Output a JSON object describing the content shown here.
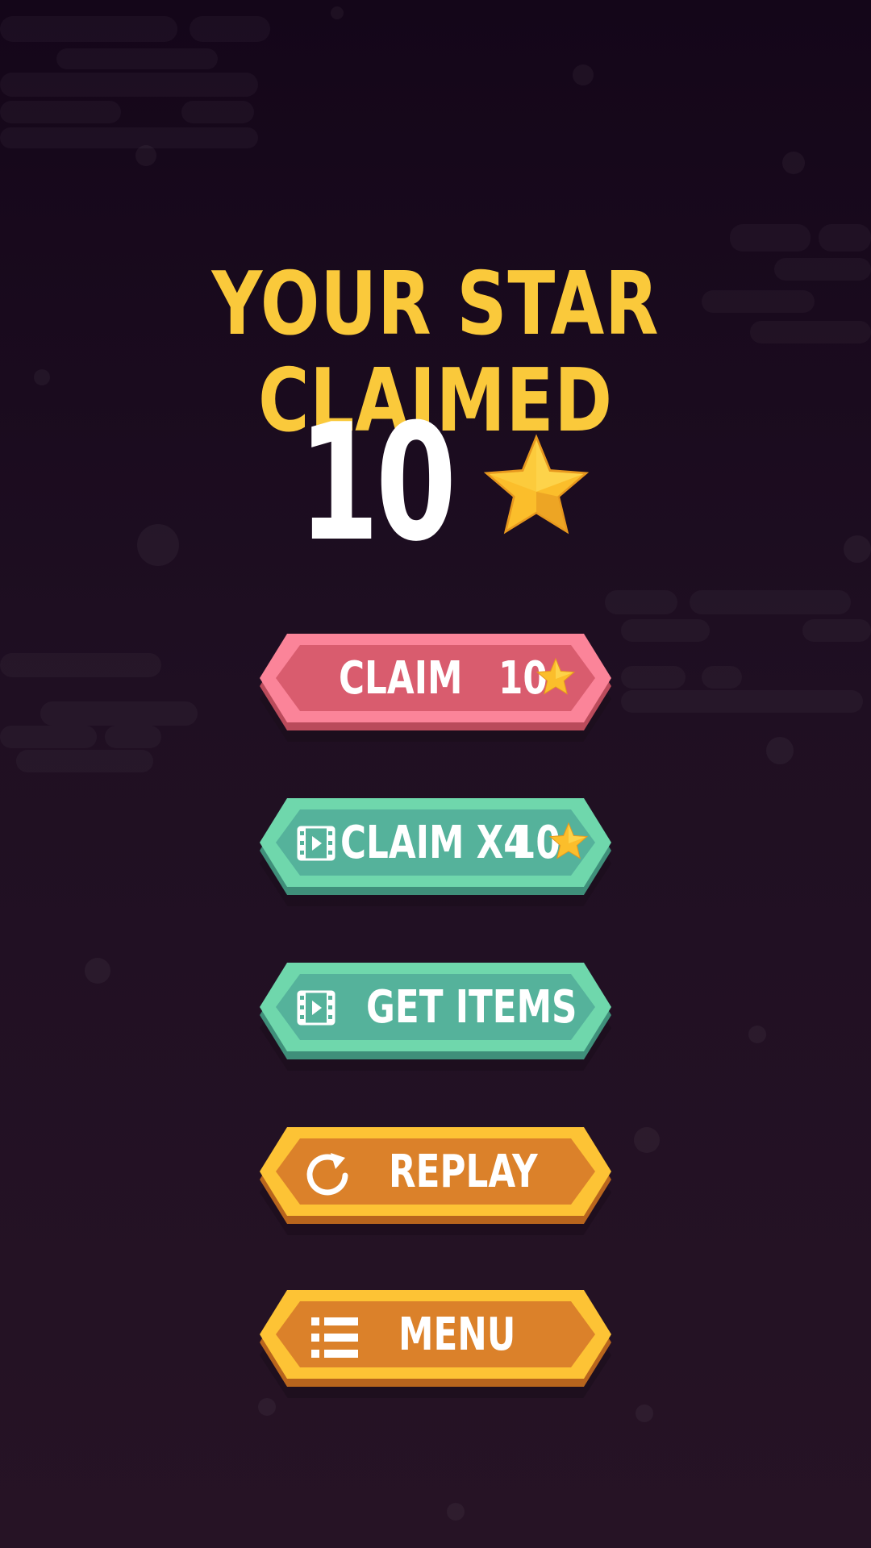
{
  "title": "YOUR STAR CLAIMED",
  "reward": {
    "amount": "10",
    "icon": "star-icon"
  },
  "buttons": {
    "claim": {
      "label": "CLAIM",
      "amount": "10",
      "icon": "star-icon",
      "color": "#d95c6e",
      "border": "#fb8499"
    },
    "claim_x4": {
      "label": "CLAIM X4",
      "amount": "10",
      "icon": "video-film-icon",
      "color": "#55b29b",
      "border": "#6fd7ac"
    },
    "get_items": {
      "label": "GET ITEMS",
      "icon": "video-film-icon",
      "color": "#55b29b",
      "border": "#6fd7ac"
    },
    "replay": {
      "label": "REPLAY",
      "icon": "replay-arrow-icon",
      "color": "#db812a",
      "border": "#fdc335"
    },
    "menu": {
      "label": "MENU",
      "icon": "list-menu-icon",
      "color": "#db812a",
      "border": "#fdc335"
    }
  },
  "colors": {
    "title": "#fac93b",
    "background": "#1c0c1f",
    "star": "#fbbe2b"
  }
}
